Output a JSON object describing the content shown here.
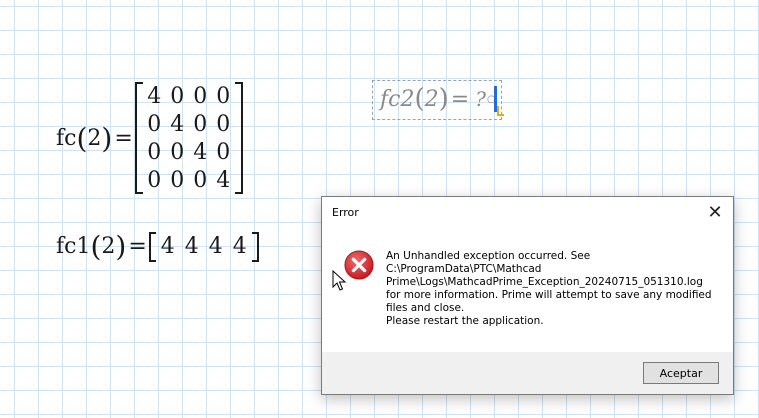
{
  "worksheet": {
    "expr1": {
      "func": "fc",
      "arg": "2",
      "matrix": [
        [
          "4",
          "0",
          "0",
          "0"
        ],
        [
          "0",
          "4",
          "0",
          "0"
        ],
        [
          "0",
          "0",
          "4",
          "0"
        ],
        [
          "0",
          "0",
          "0",
          "4"
        ]
      ]
    },
    "expr2": {
      "func": "fc2",
      "arg": "2",
      "result": "?"
    },
    "expr3": {
      "func": "fc1",
      "arg": "2",
      "vector": [
        "4",
        "4",
        "4",
        "4"
      ]
    }
  },
  "dialog": {
    "title": "Error",
    "close_symbol": "✕",
    "message_lines": [
      "An Unhandled exception occurred. See",
      "C:\\ProgramData\\PTC\\Mathcad",
      "Prime\\Logs\\MathcadPrime_Exception_20240715_051310.log",
      "for more information. Prime will attempt to save any modified",
      "files and close.",
      "Please restart the application."
    ],
    "button_label": "Aceptar",
    "icon": "error-icon",
    "colors": {
      "icon_red": "#d9252a"
    }
  }
}
